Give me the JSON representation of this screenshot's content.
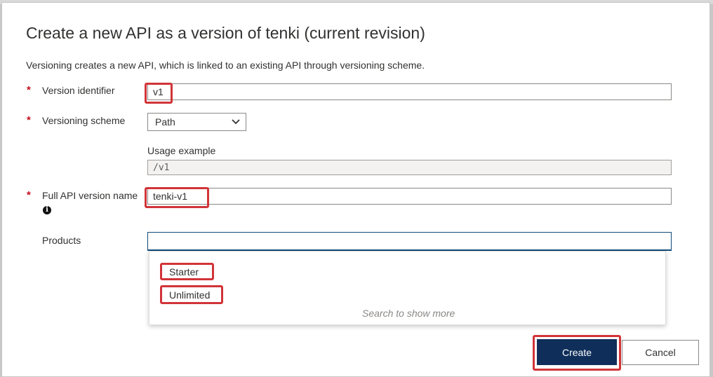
{
  "dialog": {
    "title": "Create a new API as a version of tenki (current revision)",
    "description": "Versioning creates a new API, which is linked to an existing API through versioning scheme."
  },
  "form": {
    "required_marker": "*",
    "version_identifier": {
      "label": "Version identifier",
      "value": "v1"
    },
    "versioning_scheme": {
      "label": "Versioning scheme",
      "selected": "Path"
    },
    "usage_example": {
      "label": "Usage example",
      "value": "/v1"
    },
    "full_api_version_name": {
      "label": "Full API version name",
      "value": "tenki-v1",
      "info_icon": "info-icon"
    },
    "products": {
      "label": "Products",
      "value": "",
      "options": [
        "Starter",
        "Unlimited"
      ],
      "hint": "Search to show more"
    }
  },
  "actions": {
    "create_label": "Create",
    "cancel_label": "Cancel"
  },
  "colors": {
    "primary": "#0f2f5a",
    "highlight": "#d13438",
    "required": "#c50f1f"
  }
}
